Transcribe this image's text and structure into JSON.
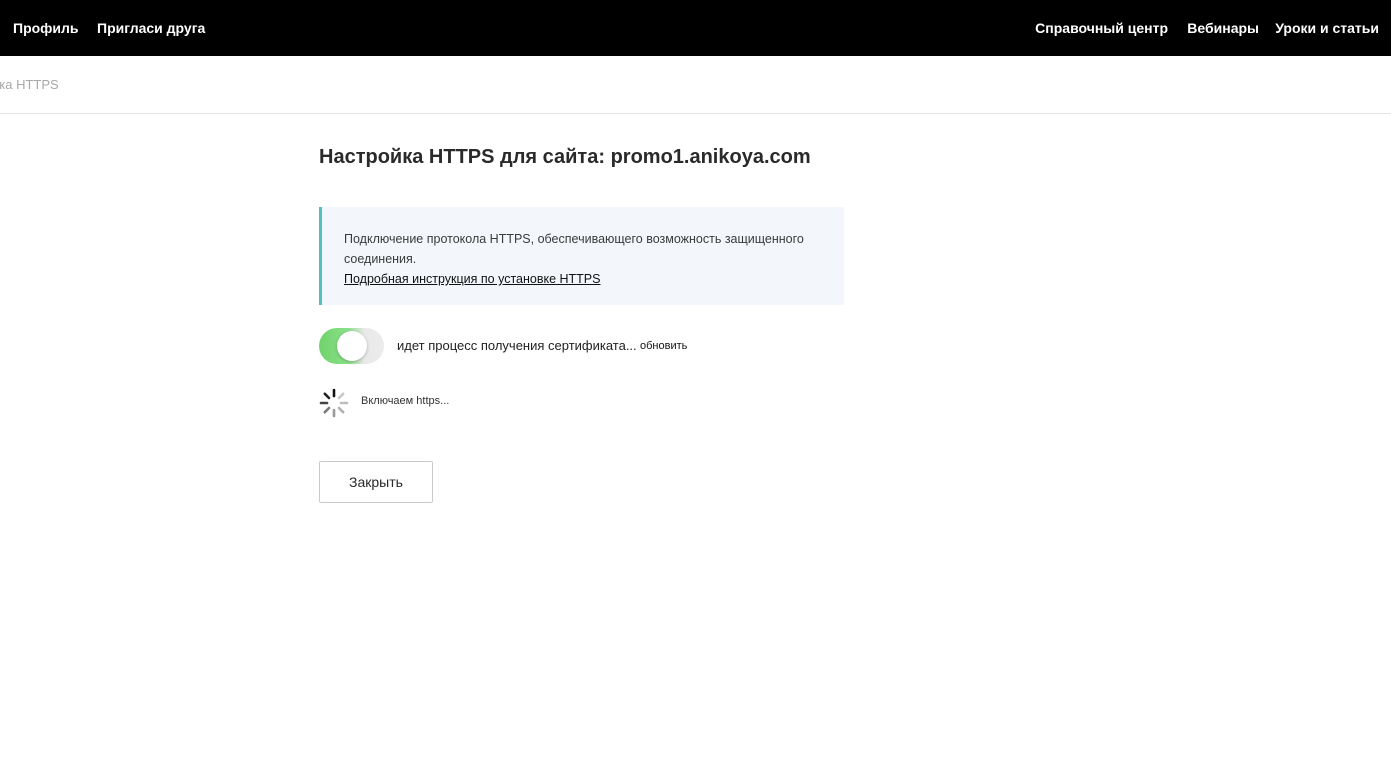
{
  "topnav": {
    "profile": "Профиль",
    "invite": "Пригласи друга",
    "help_center": "Справочный центр",
    "webinars": "Вебинары",
    "lessons": "Уроки и статьи"
  },
  "breadcrumb": {
    "current": "йка HTTPS"
  },
  "page": {
    "title": "Настройка HTTPS для сайта: promo1.anikoya.com"
  },
  "info": {
    "text": "Подключение протокола HTTPS, обеспечивающего возможность защищенного соединения.",
    "link": "Подробная инструкция по установке HTTPS",
    "accent_color": "#4fc3c3"
  },
  "https_toggle": {
    "state": "on",
    "color": "#6fd36a",
    "status_text": "идет процесс получения сертификата...",
    "refresh_label": "обновить"
  },
  "progress": {
    "icon": "spinner-icon",
    "text": "Включаем https..."
  },
  "actions": {
    "close_label": "Закрыть"
  }
}
